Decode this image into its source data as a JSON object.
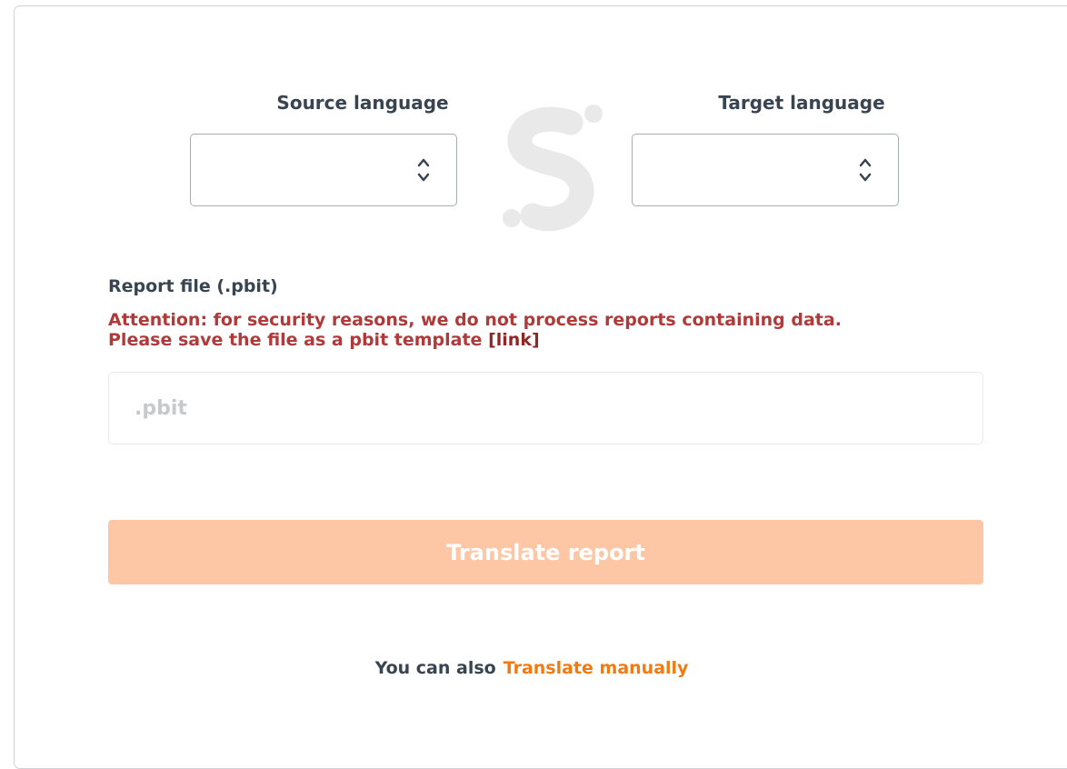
{
  "form": {
    "source_label": "Source language",
    "target_label": "Target language",
    "source_value": "",
    "target_value": "",
    "report_label": "Report file (.pbit)",
    "attention_line1": "Attention: for security reasons, we do not process reports containing data.",
    "attention_line2": "Please save the file as a pbit template",
    "attention_link": "[link]",
    "file_placeholder": ".pbit",
    "translate_button": "Translate report"
  },
  "footer": {
    "prefix": "You can also",
    "link": "Translate manually"
  },
  "icons": {
    "select_arrow": "chevron-up-down-icon",
    "logo": "brand-s-logo"
  },
  "colors": {
    "text": "#384450",
    "warning": "#b03a3a",
    "accent": "#f17a12",
    "button_disabled": "#fdc7a6"
  }
}
